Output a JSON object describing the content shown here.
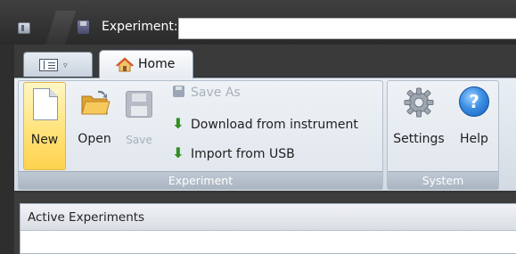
{
  "window": {
    "title_label": "Experiment:",
    "title_value": ""
  },
  "tabs": {
    "app_menu_caret": "▿",
    "home_label": "Home"
  },
  "ribbon": {
    "groups": {
      "experiment": "Experiment",
      "system": "System"
    },
    "buttons": {
      "new": "New",
      "open": "Open",
      "save": "Save",
      "save_as": "Save As",
      "download": "Download from instrument",
      "import_usb": "Import from USB",
      "settings": "Settings",
      "help": "Help",
      "help_glyph": "?"
    }
  },
  "panel": {
    "header": "Active Experiments"
  },
  "colors": {
    "accent_selected": "#ffe37a",
    "download_arrow": "#2f8f1f",
    "help_blue": "#3a8ee4"
  },
  "icons": [
    "app-icon",
    "quick-save-icon",
    "app-menu-icon",
    "home-icon",
    "new-document-icon",
    "open-folder-icon",
    "save-floppy-icon",
    "save-as-icon",
    "download-arrow-icon",
    "import-arrow-icon",
    "gear-icon",
    "help-icon"
  ]
}
